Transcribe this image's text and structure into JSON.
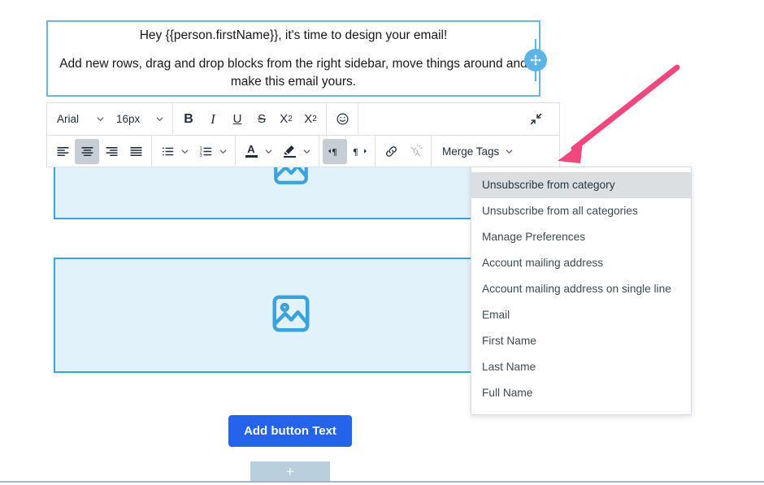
{
  "editor": {
    "text_block": {
      "line1": "Hey {{person.firstName}}, it's time to design your email!",
      "line2": "Add new rows, drag and drop blocks from the right sidebar, move things around and make this email yours."
    },
    "drag_handle_icon": "move-icon"
  },
  "toolbar": {
    "row1": {
      "font_family": "Arial",
      "font_size": "16px",
      "bold_label": "B",
      "italic_label": "I",
      "underline_label": "U",
      "strikethrough_label": "S",
      "superscript_label": "X",
      "superscript_sup": "2",
      "subscript_label": "X",
      "subscript_sub": "2",
      "emoji_icon": "emoji-smiley-icon",
      "collapse_icon": "collapse-toolbar-icon"
    },
    "row2": {
      "align_left_icon": "align-left-icon",
      "align_center_icon": "align-center-icon",
      "align_right_icon": "align-right-icon",
      "align_justify_icon": "align-justify-icon",
      "bullet_list_icon": "bullet-list-icon",
      "numbered_list_icon": "numbered-list-icon",
      "text_color_label": "A",
      "highlight_icon": "highlighter-pen-icon",
      "ltr_icon": "text-direction-ltr-icon",
      "rtl_icon": "text-direction-rtl-icon",
      "link_icon": "link-icon",
      "unlink_icon": "unlink-icon",
      "merge_tags_label": "Merge Tags",
      "active_alignment": "align-center",
      "active_direction": "ltr"
    }
  },
  "merge_tags_dropdown": {
    "open": true,
    "highlighted_index": 0,
    "items": [
      "Unsubscribe from category",
      "Unsubscribe from all categories",
      "Manage Preferences",
      "Account mailing address",
      "Account mailing address on single line",
      "Email",
      "First Name",
      "Last Name",
      "Full Name"
    ]
  },
  "content_blocks": {
    "image_block_1_icon": "image-placeholder-icon",
    "image_block_2_icon": "image-placeholder-icon",
    "button_label": "Add button Text",
    "add_row_label": "+"
  },
  "annotation": {
    "arrow_color": "#f0487e",
    "points_to": "Merge Tags"
  },
  "colors": {
    "block_border_blue": "#3aa3dc",
    "block_fill_blue": "#e2f2fb",
    "text_block_border": "#6cb7e0",
    "button_blue": "#2563eb",
    "drag_handle_blue": "#5bb4e5",
    "dropdown_highlight": "#dcdfe2",
    "toolbar_active": "#c6cdd4",
    "add_row_bar": "#b9cfdd"
  }
}
